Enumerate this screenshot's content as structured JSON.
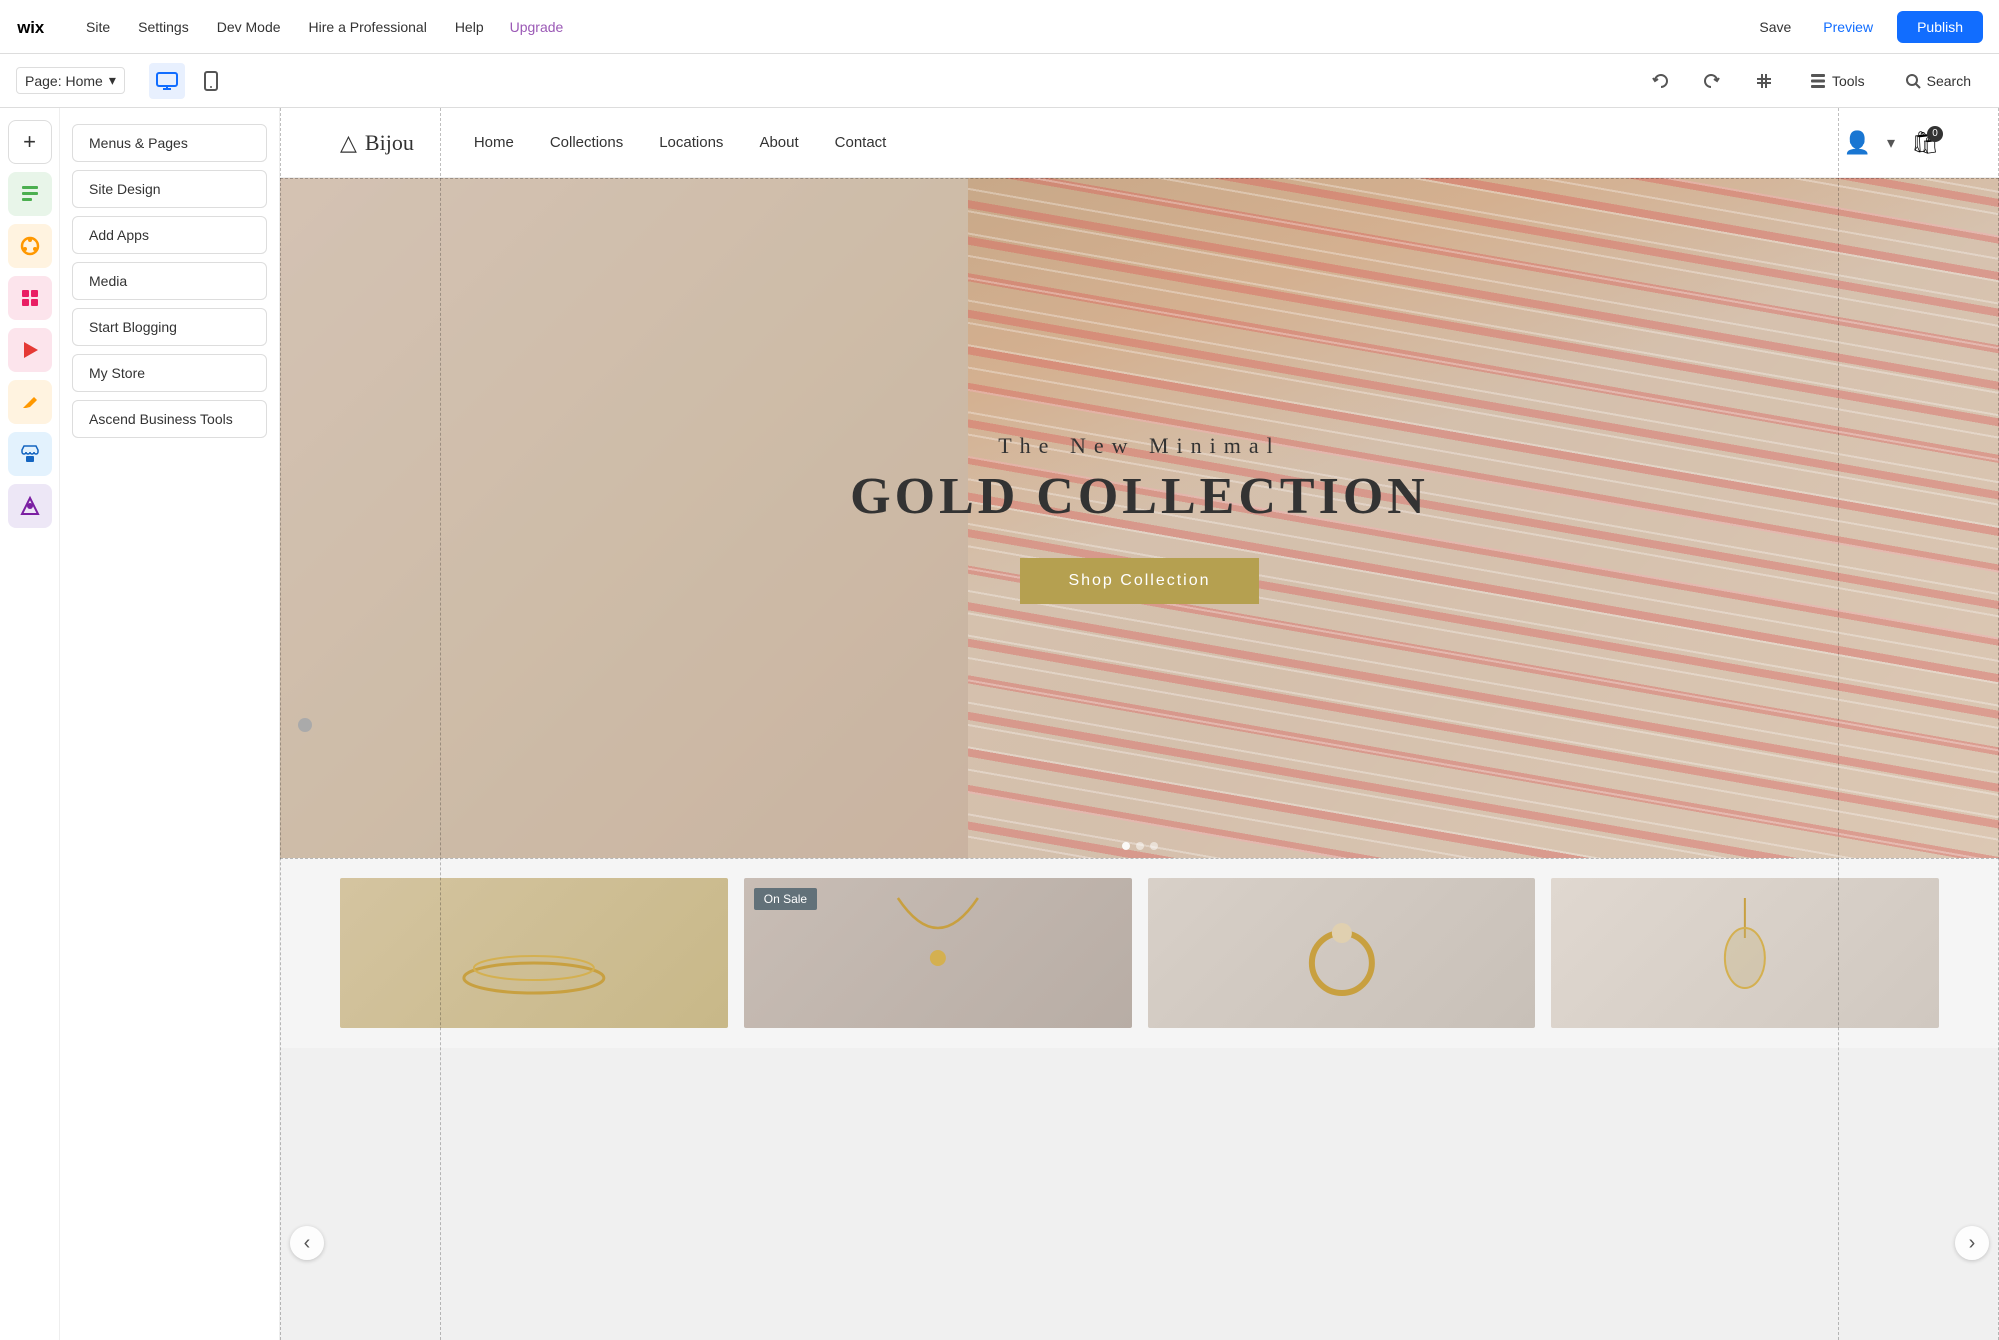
{
  "topbar": {
    "logo_alt": "Wix",
    "nav_items": [
      "Site",
      "Settings",
      "Dev Mode",
      "Hire a Professional",
      "Help",
      "Upgrade"
    ],
    "upgrade_label": "Upgrade",
    "save_label": "Save",
    "preview_label": "Preview",
    "publish_label": "Publish"
  },
  "secondbar": {
    "page_selector_label": "Page: Home",
    "tools_label": "Tools",
    "search_label": "Search"
  },
  "sidebar": {
    "add_label": "+",
    "items": [
      {
        "id": "pages",
        "label": "Menus & Pages",
        "icon": "☰"
      },
      {
        "id": "design",
        "label": "Site Design",
        "icon": "🎨"
      },
      {
        "id": "apps",
        "label": "Add Apps",
        "icon": "⊞"
      },
      {
        "id": "media",
        "label": "Media",
        "icon": "▶"
      },
      {
        "id": "blog",
        "label": "Start Blogging",
        "icon": "✏"
      },
      {
        "id": "store",
        "label": "My Store",
        "icon": "🛍"
      },
      {
        "id": "ascend",
        "label": "Ascend Business Tools",
        "icon": "A"
      }
    ]
  },
  "panel": {
    "buttons": [
      "Menus & Pages",
      "Site Design",
      "Add Apps",
      "Media",
      "Start Blogging",
      "My Store",
      "Ascend Business Tools"
    ]
  },
  "site_header": {
    "logo_icon": "△",
    "logo_text": "Bijou",
    "nav_items": [
      "Home",
      "Collections",
      "Locations",
      "About",
      "Contact"
    ],
    "active_nav": "Home",
    "cart_count": "0"
  },
  "hero": {
    "subtitle": "The New Minimal",
    "title": "GOLD COLLECTION",
    "cta_label": "Shop Collection"
  },
  "products": {
    "on_sale_label": "On Sale",
    "items": [
      {
        "id": 1,
        "has_badge": false
      },
      {
        "id": 2,
        "has_badge": true
      },
      {
        "id": 3,
        "has_badge": false
      },
      {
        "id": 4,
        "has_badge": false
      }
    ]
  },
  "arrows": {
    "left": "‹",
    "right": "›"
  },
  "colors": {
    "publish_btn": "#116dff",
    "upgrade_link": "#9b59b6",
    "hero_btn": "#b5a050"
  }
}
